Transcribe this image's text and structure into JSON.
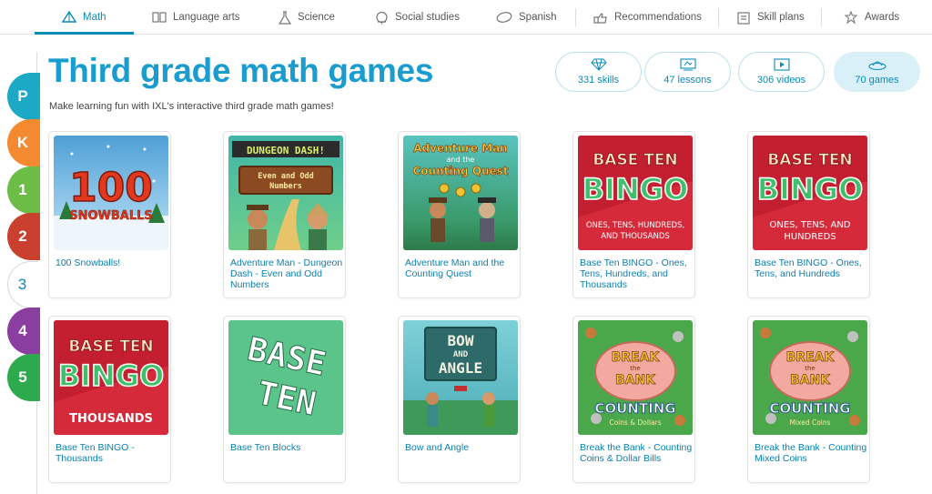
{
  "nav": {
    "items": [
      {
        "label": "Math",
        "icon": "triangle-icon",
        "active": true
      },
      {
        "label": "Language arts",
        "icon": "book-icon"
      },
      {
        "label": "Science",
        "icon": "flask-icon"
      },
      {
        "label": "Social studies",
        "icon": "globe-icon"
      },
      {
        "label": "Spanish",
        "icon": "speech-icon"
      },
      {
        "label": "Recommendations",
        "icon": "recommend-icon"
      },
      {
        "label": "Skill plans",
        "icon": "skill-plans-icon"
      },
      {
        "label": "Awards",
        "icon": "awards-icon"
      }
    ]
  },
  "grades": [
    {
      "label": "P",
      "color": "#1ba9c6"
    },
    {
      "label": "K",
      "color": "#f48a30"
    },
    {
      "label": "1",
      "color": "#6cbd45"
    },
    {
      "label": "2",
      "color": "#c9412e"
    },
    {
      "label": "3",
      "color": "#ffffff"
    },
    {
      "label": "4",
      "color": "#8a3fa0"
    },
    {
      "label": "5",
      "color": "#2eaa4e"
    }
  ],
  "page": {
    "title": "Third grade math games",
    "subtitle": "Make learning fun with IXL's interactive third grade math games!"
  },
  "stats": [
    {
      "label": "331 skills",
      "icon": "diamond-icon"
    },
    {
      "label": "47 lessons",
      "icon": "lesson-icon"
    },
    {
      "label": "306 videos",
      "icon": "video-icon"
    },
    {
      "label": "70 games",
      "icon": "game-ufo-icon",
      "selected": true
    }
  ],
  "games": [
    {
      "title": "100 Snowballs!",
      "art": "100\nSNOWBALLS"
    },
    {
      "title": "Adventure Man - Dungeon Dash - Even and Odd Numbers",
      "art": "DUNGEON DASH!\nEven and Odd\nNumbers"
    },
    {
      "title": "Adventure Man and the Counting Quest",
      "art": "Adventure Man\nand the\nCounting Quest"
    },
    {
      "title": "Base Ten BINGO - Ones, Tens, Hundreds, and Thousands",
      "art": "BASE TEN\nBINGO\nONES, TENS, HUNDREDS,\nAND THOUSANDS"
    },
    {
      "title": "Base Ten BINGO - Ones, Tens, and Hundreds",
      "art": "BASE TEN\nBINGO\nONES, TENS, AND\nHUNDREDS"
    },
    {
      "title": "Base Ten BINGO - Thousands",
      "art": "BASE TEN\nBINGO\nTHOUSANDS"
    },
    {
      "title": "Base Ten Blocks",
      "art": "BASE\nTEN"
    },
    {
      "title": "Bow and Angle",
      "art": "BOW\nAND\nANGLE"
    },
    {
      "title": "Break the Bank - Counting Coins & Dollar Bills",
      "art": "BREAK\nthe\nBANK\nCOUNTING\nCoins & Dollars"
    },
    {
      "title": "Break the Bank - Counting Mixed Coins",
      "art": "BREAK\nthe\nBANK\nCOUNTING\nMixed Coins"
    }
  ]
}
